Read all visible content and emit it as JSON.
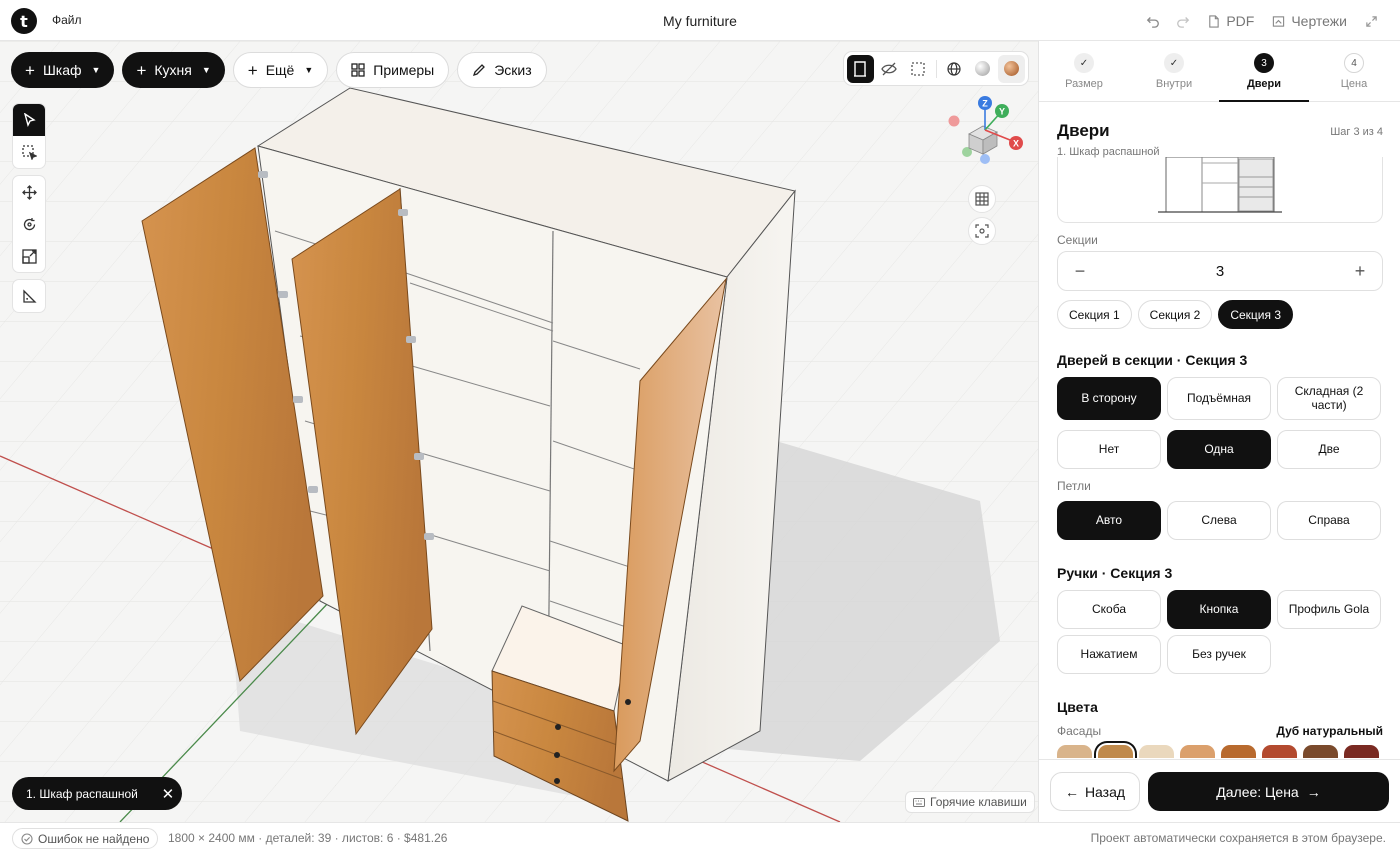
{
  "topbar": {
    "logo_letter": "t",
    "file_menu": "Файл",
    "title": "My furniture",
    "pdf_label": "PDF",
    "drawings_label": "Чертежи"
  },
  "toolbar": {
    "cabinet": "Шкаф",
    "kitchen": "Кухня",
    "more": "Ещё",
    "examples": "Примеры",
    "sketch": "Эскиз"
  },
  "gizmo": {
    "z": "Z",
    "y": "Y",
    "x": "X"
  },
  "viewport": {
    "selection_chip": "1. Шкаф распашной",
    "hotkeys": "Горячие клавиши"
  },
  "steps": [
    {
      "num": "✓",
      "label": "Размер",
      "state": "done"
    },
    {
      "num": "✓",
      "label": "Внутри",
      "state": "done"
    },
    {
      "num": "3",
      "label": "Двери",
      "state": "current"
    },
    {
      "num": "4",
      "label": "Цена",
      "state": "todo"
    }
  ],
  "panel": {
    "title": "Двери",
    "step_of": "Шаг 3 из 4",
    "item_name": "1. Шкаф распашной",
    "sections_label": "Секции",
    "sections_value": "3",
    "section_pills": [
      "Секция 1",
      "Секция 2",
      "Секция 3"
    ],
    "doors_heading": "Дверей в секции · Секция 3",
    "door_types": [
      "В сторону",
      "Подъёмная",
      "Складная (2 части)"
    ],
    "door_counts": [
      "Нет",
      "Одна",
      "Две"
    ],
    "hinges_label": "Петли",
    "hinges": [
      "Авто",
      "Слева",
      "Справа"
    ],
    "handles_heading": "Ручки · Секция 3",
    "handles": [
      "Скоба",
      "Кнопка",
      "Профиль Gola",
      "Нажатием",
      "Без ручек"
    ],
    "colors_heading": "Цвета",
    "facades_label": "Фасады",
    "facade_value": "Дуб натуральный",
    "swatch_colors": [
      "#d9b48b",
      "#c08a4c",
      "#ead8bd",
      "#dba06c",
      "#b86a2e",
      "#b34a2f",
      "#7a4a2c",
      "#7a2a22"
    ],
    "back": "Назад",
    "next": "Далее: Цена"
  },
  "status": {
    "errors": "Ошибок не найдено",
    "stats": "1800 × 2400 мм · деталей: 39 · листов: 6 · $481.26",
    "autosave": "Проект автоматически сохраняется в этом браузере."
  },
  "colors": {
    "accent": "#111111",
    "wood": "#c98a48",
    "carcass": "#f3efe8",
    "axis_x": "#e04b4b",
    "axis_y": "#3fae5b",
    "axis_z": "#3a7be0"
  }
}
